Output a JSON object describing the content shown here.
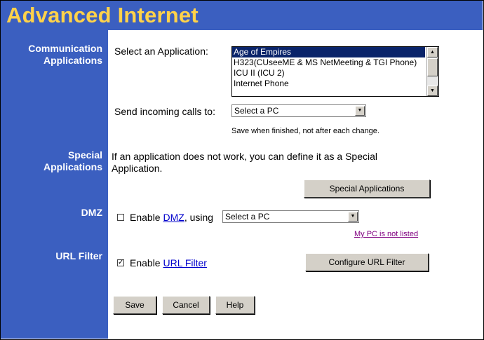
{
  "title": "Advanced Internet",
  "sidebar": {
    "comm_line1": "Communication",
    "comm_line2": "Applications",
    "special_line1": "Special",
    "special_line2": "Applications",
    "dmz": "DMZ",
    "url_filter": "URL Filter"
  },
  "comm": {
    "select_label": "Select an Application:",
    "apps": [
      "Age of Empires",
      "H323(CUseeME & MS NetMeeting & TGI Phone)",
      "ICU II (ICU 2)",
      "Internet Phone"
    ],
    "selected_app": "Age of Empires",
    "send_label": "Send incoming calls to:",
    "send_value": "Select a PC",
    "save_note": "Save when finished, not after each change."
  },
  "special": {
    "line1": "If an application does not work, you can define it as a Special",
    "line2": "Application.",
    "button": "Special Applications"
  },
  "dmz": {
    "checked": false,
    "enable_text": "Enable ",
    "link": "DMZ",
    "using_text": ", using",
    "select_value": "Select a PC",
    "not_listed": "My PC is not listed"
  },
  "url": {
    "checked": true,
    "enable_text": "Enable ",
    "link": "URL Filter",
    "button": "Configure URL Filter"
  },
  "actions": {
    "save": "Save",
    "cancel": "Cancel",
    "help": "Help"
  },
  "colors": {
    "panel_blue": "#3b5fc0",
    "title_yellow": "#ffd24a",
    "selection_navy": "#0a246a",
    "link_blue": "#0000cc",
    "visited_purple": "#800080"
  }
}
